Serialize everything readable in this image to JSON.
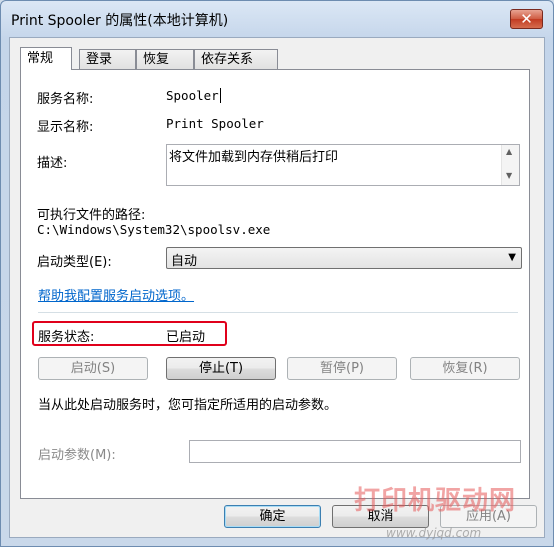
{
  "window": {
    "title": "Print Spooler 的属性(本地计算机)",
    "close_glyph": "✕"
  },
  "tabs": [
    {
      "label": "常规"
    },
    {
      "label": "登录"
    },
    {
      "label": "恢复"
    },
    {
      "label": "依存关系"
    }
  ],
  "general": {
    "service_name_label": "服务名称:",
    "service_name_value": "Spooler",
    "display_name_label": "显示名称:",
    "display_name_value": "Print Spooler",
    "description_label": "描述:",
    "description_value": "将文件加载到内存供稍后打印",
    "path_label": "可执行文件的路径:",
    "path_value": "C:\\Windows\\System32\\spoolsv.exe",
    "startup_type_label": "启动类型(E):",
    "startup_type_value": "自动",
    "help_link": "帮助我配置服务启动选项。",
    "status_label": "服务状态:",
    "status_value": "已启动",
    "start_button": "启动(S)",
    "stop_button": "停止(T)",
    "pause_button": "暂停(P)",
    "resume_button": "恢复(R)",
    "hint_text": "当从此处启动服务时，您可指定所适用的启动参数。",
    "param_label": "启动参数(M):",
    "param_value": ""
  },
  "footer": {
    "ok_button": "确定",
    "cancel_button": "取消",
    "apply_button": "应用(A)"
  },
  "watermark": {
    "text": "打印机驱动网",
    "url": "www.dyjqd.com"
  },
  "colors": {
    "status_highlight": "#e0001b",
    "link": "#0066cc"
  }
}
